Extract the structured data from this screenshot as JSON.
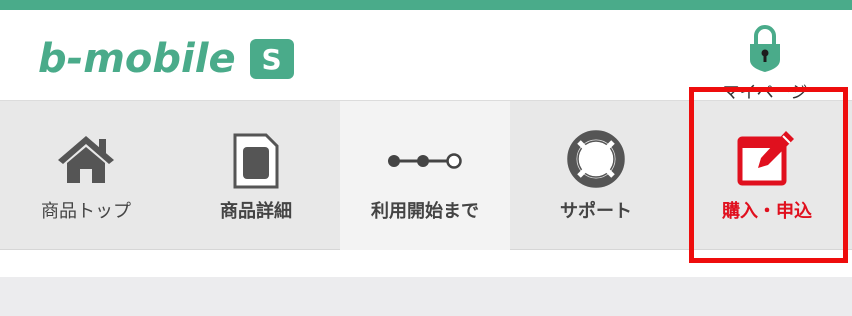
{
  "brand": {
    "logo_text": "b-mobile",
    "badge": "S",
    "accent_color": "#4aab8a"
  },
  "header": {
    "mypage_label": "マイページ",
    "mypage_icon": "lock-icon"
  },
  "nav": {
    "items": [
      {
        "label": "商品トップ",
        "icon": "home-icon"
      },
      {
        "label": "商品詳細",
        "icon": "sim-card-icon"
      },
      {
        "label": "利用開始まで",
        "icon": "steps-icon",
        "active": true
      },
      {
        "label": "サポート",
        "icon": "lifebuoy-icon"
      },
      {
        "label": "購入・申込",
        "icon": "edit-form-icon",
        "highlight_color": "#e0101e"
      }
    ]
  }
}
